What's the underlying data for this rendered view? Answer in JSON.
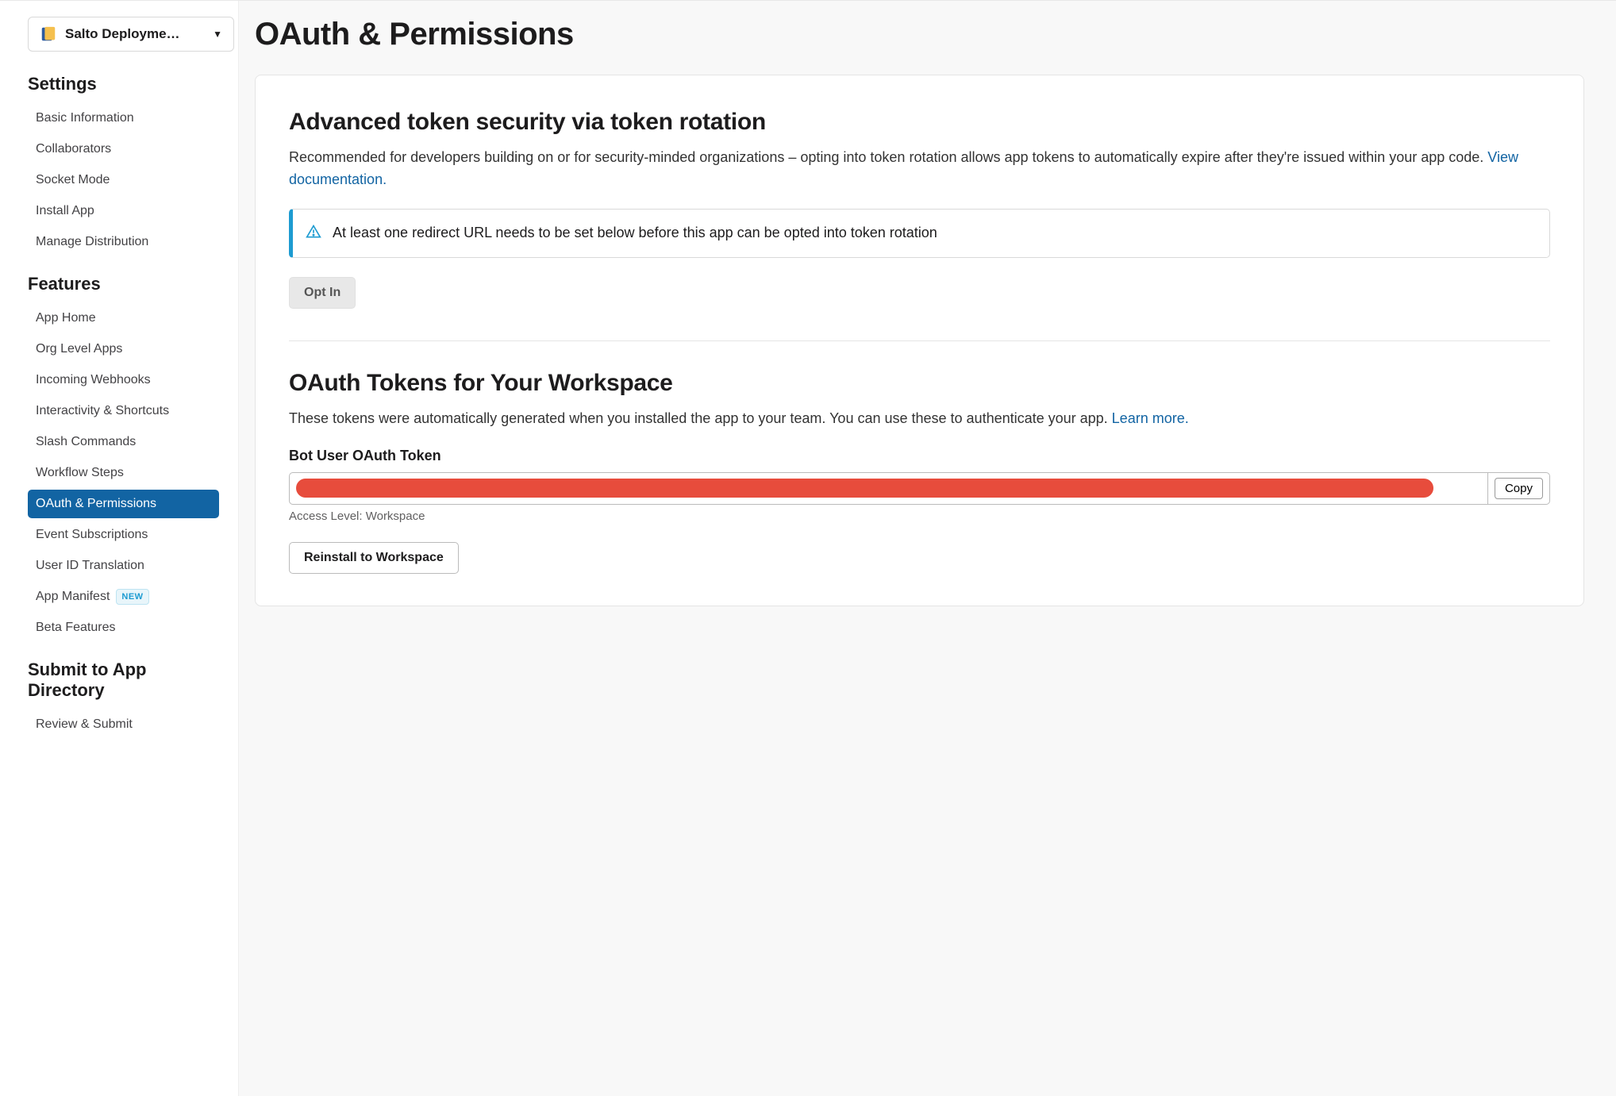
{
  "appSelector": {
    "label": "Salto Deployme…"
  },
  "sidebar": {
    "sections": [
      {
        "title": "Settings",
        "items": [
          {
            "label": "Basic Information"
          },
          {
            "label": "Collaborators"
          },
          {
            "label": "Socket Mode"
          },
          {
            "label": "Install App"
          },
          {
            "label": "Manage Distribution"
          }
        ]
      },
      {
        "title": "Features",
        "items": [
          {
            "label": "App Home"
          },
          {
            "label": "Org Level Apps"
          },
          {
            "label": "Incoming Webhooks"
          },
          {
            "label": "Interactivity & Shortcuts"
          },
          {
            "label": "Slash Commands"
          },
          {
            "label": "Workflow Steps"
          },
          {
            "label": "OAuth & Permissions",
            "active": true
          },
          {
            "label": "Event Subscriptions"
          },
          {
            "label": "User ID Translation"
          },
          {
            "label": "App Manifest",
            "badge": "NEW"
          },
          {
            "label": "Beta Features"
          }
        ]
      },
      {
        "title": "Submit to App Directory",
        "items": [
          {
            "label": "Review & Submit"
          }
        ]
      }
    ]
  },
  "page": {
    "title": "OAuth & Permissions"
  },
  "tokenRotation": {
    "heading": "Advanced token security via token rotation",
    "body": "Recommended for developers building on or for security-minded organizations – opting into token rotation allows app tokens to automatically expire after they're issued within your app code. ",
    "docLink": "View documentation.",
    "alert": "At least one redirect URL needs to be set below before this app can be opted into token rotation",
    "optInLabel": "Opt In"
  },
  "tokens": {
    "heading": "OAuth Tokens for Your Workspace",
    "body": "These tokens were automatically generated when you installed the app to your team. You can use these to authenticate your app. ",
    "learnMore": "Learn more.",
    "botTokenLabel": "Bot User OAuth Token",
    "copyLabel": "Copy",
    "accessLevel": "Access Level: Workspace",
    "reinstallLabel": "Reinstall to Workspace"
  }
}
